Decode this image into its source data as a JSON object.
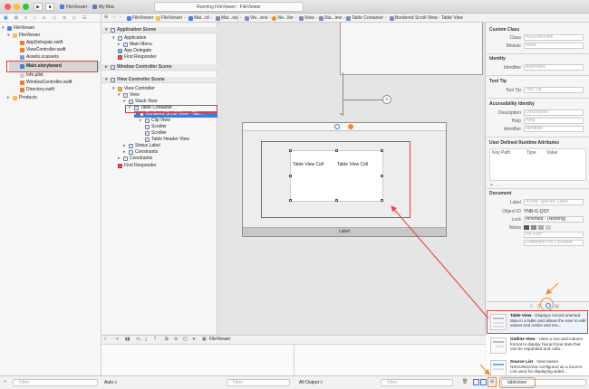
{
  "toolbar": {
    "scheme": "FileViewer",
    "destination": "My Mac",
    "status": "Running FileViewer : FileViewer"
  },
  "navigator": {
    "project": "FileViewer",
    "group": "FileViewer",
    "files": [
      "AppDelegate.swift",
      "ViewController.swift",
      "Assets.xcassets",
      "Main.storyboard",
      "Info.plist",
      "WindowController.swift",
      "Directory.swift"
    ],
    "products": "Products",
    "filter_placeholder": "Filter"
  },
  "jumpbar": {
    "items": [
      "FileViewer",
      "FileViewer",
      "Mai...rd",
      "Mai...se)",
      "Vie...ene",
      "Vie...ller",
      "View",
      "Sta...iew",
      "Table Container",
      "Bordered Scroll View - Table View"
    ]
  },
  "outline": {
    "sections": [
      {
        "title": "Application Scene",
        "items": [
          "Application",
          "Main Menu",
          "App Delegate",
          "First Responder"
        ]
      },
      {
        "title": "Window Controller Scene"
      },
      {
        "title": "View Controller Scene",
        "items": [
          "View Controller",
          "View",
          "Stack View",
          "Table Container",
          "Bordered Scroll View - Tab...",
          "Clip View",
          "Scroller",
          "Scroller",
          "Table Header View",
          "Status Label",
          "Constraints",
          "Constraints",
          "First Responder"
        ]
      }
    ],
    "filter_placeholder": "Filter"
  },
  "canvas": {
    "columns": [
      "Table View Cell",
      "Table View Cell"
    ],
    "status_label": "Label"
  },
  "inspector": {
    "custom_class": {
      "title": "Custom Class",
      "class_label": "Class",
      "class_value": "NSScrollView",
      "module_label": "Module",
      "module_value": "None"
    },
    "identity": {
      "title": "Identity",
      "identifier_label": "Identifier",
      "identifier_value": "Automatic"
    },
    "tooltip": {
      "title": "Tool Tip",
      "label": "Tool Tip",
      "value": "Tool Tip"
    },
    "accessibility": {
      "title": "Accessibility Identity",
      "description_label": "Description",
      "description_value": "Description",
      "help_label": "Help",
      "help_value": "Help",
      "identifier_label": "Identifier",
      "identifier_value": "Identifier"
    },
    "runtime": {
      "title": "User Defined Runtime Attributes",
      "columns": [
        "Key Path",
        "Type",
        "Value"
      ]
    },
    "document": {
      "title": "Document",
      "label_label": "Label",
      "label_value": "Xcode Specific Label",
      "object_id_label": "Object ID",
      "object_id_value": "YNB-I1-QSY",
      "lock_label": "Lock",
      "lock_value": "Inherited - (Nothing)",
      "notes_label": "Notes",
      "notes_value": "No Font",
      "notes_comment": "Comment For Localizer"
    }
  },
  "library": {
    "items": [
      {
        "title": "Table View",
        "desc": " - Displays record-oriented data in a table and allows the user to edit values and resize and reo..."
      },
      {
        "title": "Outline View",
        "desc": " - Uses a row-and-column format to display hierarchical data that can be expanded and colla..."
      },
      {
        "title": "Source List",
        "desc": " - View based NSOutlineView configured as a Source List used for displaying sided..."
      }
    ],
    "search_value": "tableview"
  },
  "debug": {
    "target": "FileViewer",
    "auto_label": "Auto ◊",
    "all_output": "All Output ◊",
    "filter_placeholder": "Filter"
  }
}
